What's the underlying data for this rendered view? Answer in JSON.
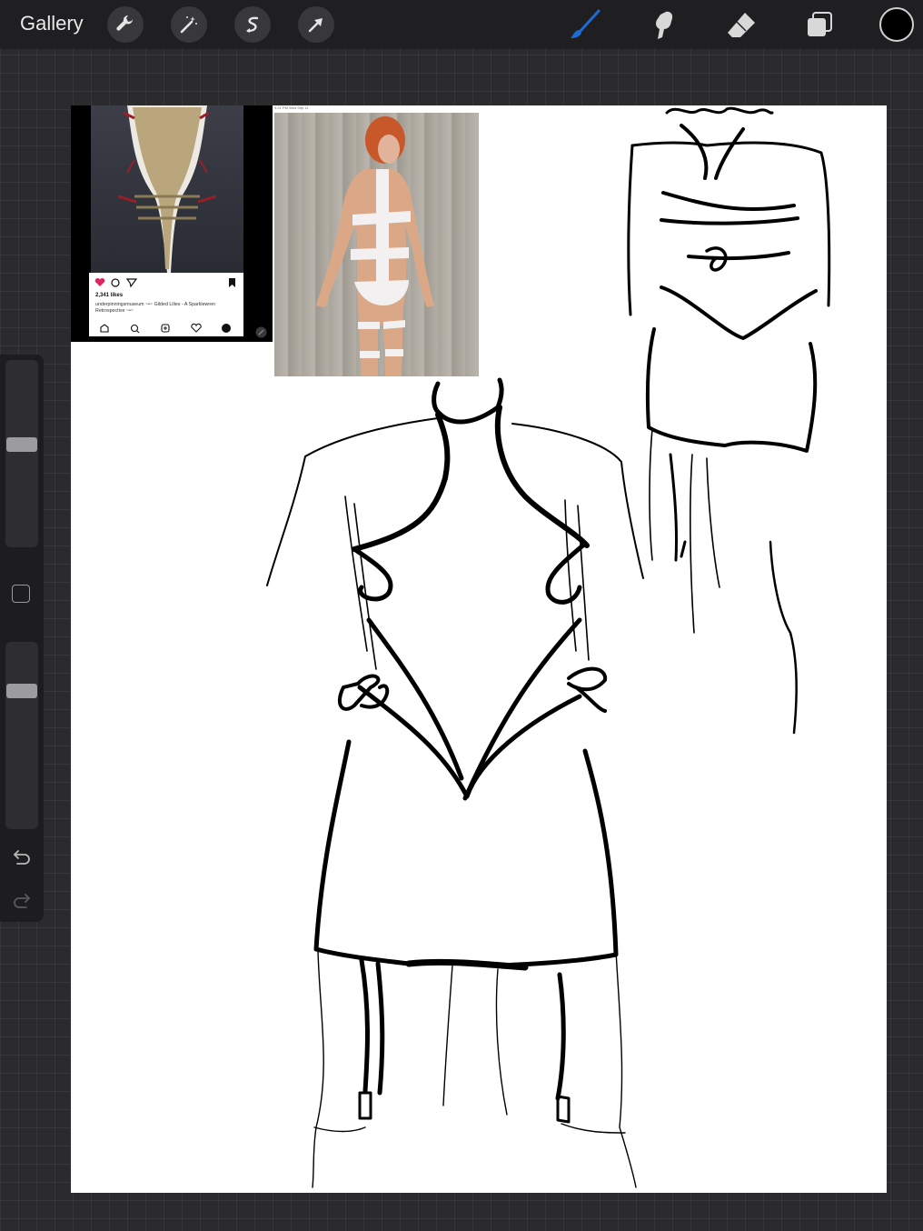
{
  "topbar": {
    "gallery_label": "Gallery",
    "left_tools": [
      "wrench-icon",
      "magic-wand-icon",
      "selection-icon",
      "transform-arrow-icon"
    ],
    "right_tools": [
      "brush-icon",
      "smudge-icon",
      "eraser-icon",
      "layers-icon"
    ],
    "active_tool": "brush-icon",
    "brush_color": "#1f6bd6",
    "current_color": "#000000"
  },
  "sidebar": {
    "brush_size_level": 0.55,
    "opacity_level": 0.76,
    "icons": [
      "modify-square-icon",
      "undo-icon",
      "redo-icon"
    ]
  },
  "reference_instagram": {
    "likes": "2,341 likes",
    "caption": "underpinningsmuseum ~•~ Gilded Lilies - A Sparklewren Retrospective ~•~",
    "nav_icons": [
      "home-icon",
      "search-icon",
      "add-icon",
      "heart-icon",
      "profile-icon"
    ]
  },
  "reference_photo": {
    "status_bar": "9:21 PM  Wed Sep 11"
  }
}
